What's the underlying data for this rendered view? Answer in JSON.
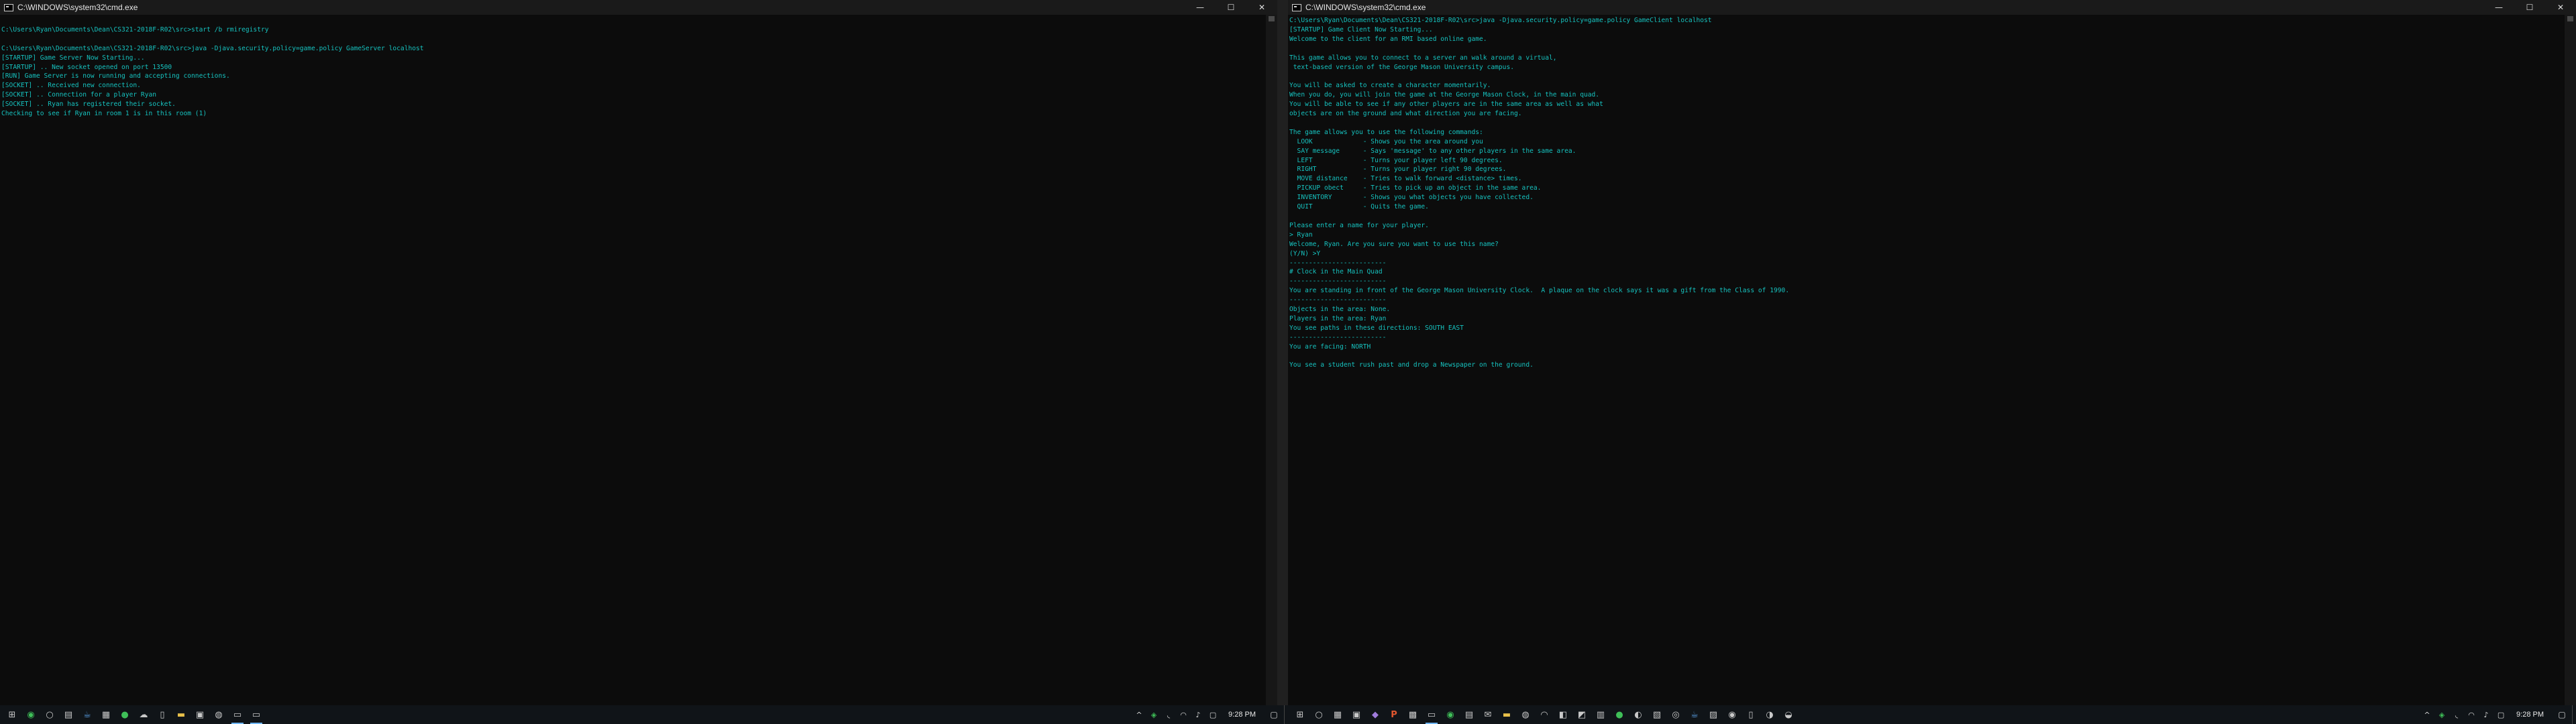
{
  "left_window": {
    "title": "C:\\WINDOWS\\system32\\cmd.exe",
    "console_lines": [
      "",
      "C:\\Users\\Ryan\\Documents\\Dean\\CS321-2018F-R02\\src>start /b rmiregistry",
      "",
      "C:\\Users\\Ryan\\Documents\\Dean\\CS321-2018F-R02\\src>java -Djava.security.policy=game.policy GameServer localhost",
      "[STARTUP] Game Server Now Starting...",
      "[STARTUP] .. New socket opened on port 13500",
      "[RUN] Game Server is now running and accepting connections.",
      "[SOCKET] .. Received new connection.",
      "[SOCKET] .. Connection for a player Ryan",
      "[SOCKET] .. Ryan has registered their socket.",
      "Checking to see if Ryan in room 1 is in this room (1)"
    ]
  },
  "right_window": {
    "title": "C:\\WINDOWS\\system32\\cmd.exe",
    "console_lines": [
      "C:\\Users\\Ryan\\Documents\\Dean\\CS321-2018F-R02\\src>java -Djava.security.policy=game.policy GameClient localhost",
      "[STARTUP] Game Client Now Starting...",
      "Welcome to the client for an RMI based online game.",
      "",
      "This game allows you to connect to a server an walk around a virtual,",
      " text-based version of the George Mason University campus.",
      "",
      "You will be asked to create a character momentarily.",
      "When you do, you will join the game at the George Mason Clock, in the main quad.",
      "You will be able to see if any other players are in the same area as well as what",
      "objects are on the ground and what direction you are facing.",
      "",
      "The game allows you to use the following commands:",
      "  LOOK             - Shows you the area around you",
      "  SAY message      - Says 'message' to any other players in the same area.",
      "  LEFT             - Turns your player left 90 degrees.",
      "  RIGHT            - Turns your player right 90 degrees.",
      "  MOVE distance    - Tries to walk forward <distance> times.",
      "  PICKUP obect     - Tries to pick up an object in the same area.",
      "  INVENTORY        - Shows you what objects you have collected.",
      "  QUIT             - Quits the game.",
      "",
      "Please enter a name for your player.",
      "> Ryan",
      "Welcome, Ryan. Are you sure you want to use this name?",
      "(Y/N) >Y",
      "-------------------------",
      "# Clock in the Main Quad",
      "-------------------------",
      "You are standing in front of the George Mason University Clock.  A plaque on the clock says it was a gift from the Class of 1990.",
      "-------------------------",
      "Objects in the area: None.",
      "Players in the area: Ryan",
      "You see paths in these directions: SOUTH EAST",
      "-------------------------",
      "You are facing: NORTH",
      "",
      "You see a student rush past and drop a Newspaper on the ground."
    ]
  },
  "window_controls": {
    "minimize": "—",
    "maximize": "☐",
    "close": "✕"
  },
  "taskbar_left": {
    "icons": [
      {
        "name": "start-icon",
        "glyph": "⊞"
      },
      {
        "name": "chrome-icon",
        "glyph": "◉"
      },
      {
        "name": "cortana-icon",
        "glyph": "○"
      },
      {
        "name": "calculator-icon",
        "glyph": "▤"
      },
      {
        "name": "java-icon",
        "glyph": "☕"
      },
      {
        "name": "taskview-icon",
        "glyph": "▦"
      },
      {
        "name": "app-icon-green",
        "glyph": "●"
      },
      {
        "name": "app-icon-cloud",
        "glyph": "☁"
      },
      {
        "name": "phone-icon",
        "glyph": "▯"
      },
      {
        "name": "folder-icon",
        "glyph": "▬"
      },
      {
        "name": "store-icon",
        "glyph": "▣"
      },
      {
        "name": "steam-icon",
        "glyph": "◍"
      },
      {
        "name": "cmd-icon",
        "glyph": "▭"
      },
      {
        "name": "cmd-icon-2",
        "glyph": "▭"
      }
    ],
    "tray_icons": [
      {
        "name": "chevron-up-icon",
        "glyph": "^"
      },
      {
        "name": "network-app-icon",
        "glyph": "◈"
      },
      {
        "name": "wifi-icon",
        "glyph": "◟"
      },
      {
        "name": "headset-icon",
        "glyph": "◠"
      },
      {
        "name": "volume-icon",
        "glyph": "♪"
      },
      {
        "name": "chat-icon",
        "glyph": "▢"
      }
    ],
    "clock": "9:28 PM"
  },
  "taskbar_right": {
    "icons": [
      {
        "name": "start-icon",
        "glyph": "⊞"
      },
      {
        "name": "cortana-icon",
        "glyph": "○"
      },
      {
        "name": "taskview-icon",
        "glyph": "▦"
      },
      {
        "name": "app-icon",
        "glyph": "▣"
      },
      {
        "name": "visual-studio-icon",
        "glyph": "◆"
      },
      {
        "name": "powerpoint-icon",
        "glyph": "P"
      },
      {
        "name": "app-icon-dark",
        "glyph": "▩"
      },
      {
        "name": "cmd-icon",
        "glyph": "▭"
      },
      {
        "name": "chrome-icon",
        "glyph": "◉"
      },
      {
        "name": "app-icon-2",
        "glyph": "▤"
      },
      {
        "name": "mail-icon",
        "glyph": "✉"
      },
      {
        "name": "folder-icon",
        "glyph": "▬"
      },
      {
        "name": "steam-icon",
        "glyph": "◍"
      },
      {
        "name": "headset-icon",
        "glyph": "◠"
      },
      {
        "name": "app-icon-3",
        "glyph": "◧"
      },
      {
        "name": "app-icon-4",
        "glyph": "◩"
      },
      {
        "name": "app-icon-5",
        "glyph": "▥"
      },
      {
        "name": "spotify-icon",
        "glyph": "●"
      },
      {
        "name": "app-icon-6",
        "glyph": "◐"
      },
      {
        "name": "app-icon-7",
        "glyph": "▧"
      },
      {
        "name": "app-icon-8",
        "glyph": "◎"
      },
      {
        "name": "java-icon",
        "glyph": "☕"
      },
      {
        "name": "app-icon-9",
        "glyph": "▨"
      },
      {
        "name": "app-icon-10",
        "glyph": "◉"
      },
      {
        "name": "phone-icon",
        "glyph": "▯"
      },
      {
        "name": "app-icon-11",
        "glyph": "◑"
      },
      {
        "name": "app-icon-12",
        "glyph": "◒"
      }
    ],
    "tray_icons": [
      {
        "name": "chevron-up-icon",
        "glyph": "^"
      },
      {
        "name": "network-app-icon",
        "glyph": "◈"
      },
      {
        "name": "wifi-icon",
        "glyph": "◟"
      },
      {
        "name": "headset-icon",
        "glyph": "◠"
      },
      {
        "name": "volume-icon",
        "glyph": "♪"
      },
      {
        "name": "chat-icon",
        "glyph": "▢"
      }
    ],
    "clock": "9:28 PM"
  },
  "colors": {
    "console_text": "#16c2bf",
    "console_bg": "#0c0c0c",
    "taskbar_bg": "#101418"
  }
}
